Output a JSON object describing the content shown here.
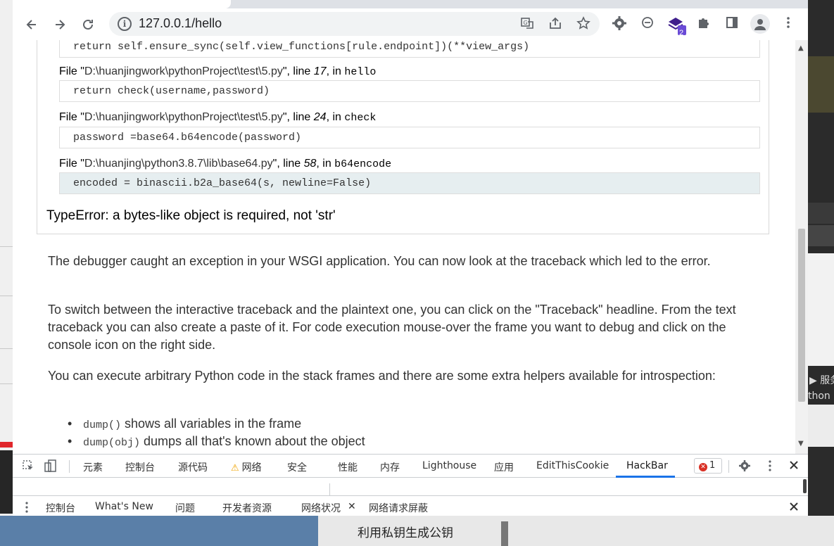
{
  "browser": {
    "url": "127.0.0.1/hello",
    "extension_badge": "2"
  },
  "traceback": {
    "top_code": "return self.ensure_sync(self.view_functions[rule.endpoint])(**view_args)",
    "frames": [
      {
        "prefix": "File \"",
        "file": "D:\\huanjingwork\\pythonProject\\test\\5.py",
        "mid": "\", line ",
        "line": "17",
        "in": ", in ",
        "func": "hello",
        "code": "return check(username,password)"
      },
      {
        "prefix": "File \"",
        "file": "D:\\huanjingwork\\pythonProject\\test\\5.py",
        "mid": "\", line ",
        "line": "24",
        "in": ", in ",
        "func": "check",
        "code": "password =base64.b64encode(password)"
      },
      {
        "prefix": "File \"",
        "file": "D:\\huanjing\\python3.8.7\\lib\\base64.py",
        "mid": "\", line ",
        "line": "58",
        "in": ", in ",
        "func": "b64encode",
        "code": "encoded = binascii.b2a_base64(s, newline=False)"
      }
    ],
    "exception": "TypeError: a bytes-like object is required, not 'str'"
  },
  "explanation": {
    "p1": "The debugger caught an exception in your WSGI application. You can now look at the traceback which led to the error.",
    "p2": "To switch between the interactive traceback and the plaintext one, you can click on the \"Traceback\" headline. From the text traceback you can also create a paste of it. For code execution mouse-over the frame you want to debug and click on the console icon on the right side.",
    "p3": "You can execute arbitrary Python code in the stack frames and there are some extra helpers available for introspection:",
    "bullets": [
      {
        "code": "dump()",
        "text": " shows all variables in the frame"
      },
      {
        "code": "dump(obj)",
        "text": " dumps all that's known about the object"
      }
    ]
  },
  "devtools": {
    "tabs": [
      "元素",
      "控制台",
      "源代码",
      "网络",
      "安全",
      "性能",
      "内存",
      "Lighthouse",
      "应用",
      "EditThisCookie",
      "HackBar"
    ],
    "active_tab": "HackBar",
    "error_count": "1",
    "drawer_tabs": [
      "控制台",
      "What's New",
      "问题",
      "开发者资源",
      "网络状况",
      "网络请求屏蔽"
    ]
  },
  "background": {
    "right_text_1": "▶ 服务",
    "right_text_2": "thon",
    "bottom_label": "利用私钥生成公钥"
  }
}
